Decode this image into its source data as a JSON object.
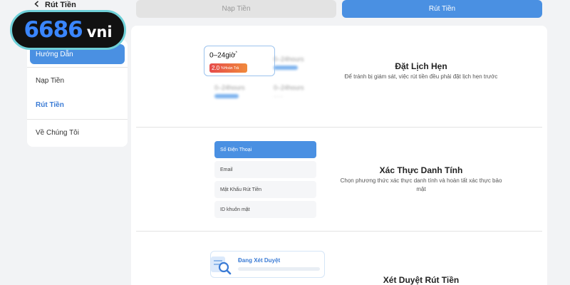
{
  "logo": {
    "number": "6686",
    "suffix": "vni"
  },
  "header": {
    "back_label": "Rút Tiền",
    "back_icon": "chevron-left-icon"
  },
  "tabs": [
    {
      "label": "Nạp Tiền",
      "active": false
    },
    {
      "label": "Rút Tiền",
      "active": true
    }
  ],
  "sidebar": {
    "items": [
      {
        "label": "Hướng Dẫn",
        "state": "highlighted"
      },
      {
        "label": "Nạp Tiền",
        "state": "normal"
      },
      {
        "label": "Rút Tiền",
        "state": "current"
      },
      {
        "label": "Về Chúng Tôi",
        "state": "normal"
      }
    ]
  },
  "sections": [
    {
      "title": "Đặt Lịch Hẹn",
      "description": "Để tránh bị giám sát, việc rút tiền đều phải đặt lịch hẹn trước",
      "illustration": {
        "card_time": "0–24giờ",
        "card_star": "*",
        "card_rate": "2.0",
        "card_rate_suffix": "%Hoàn Trả",
        "blurred_items": [
          "0–24hours",
          "0–24hours",
          "0–24hours",
          "0–24hours"
        ]
      }
    },
    {
      "title": "Xác Thực Danh Tính",
      "description": "Chọn phương thức xác thực danh tính và hoàn tất xác thực bảo mật",
      "illustration": {
        "options": [
          "Số Điện Thoại",
          "Email",
          "Mật Khẩu Rút Tiền",
          "ID khuôn mặt"
        ],
        "selected_index": 0
      }
    },
    {
      "title": "Xét Duyệt Rút Tiền",
      "illustration": {
        "status_label": "Đang Xét Duyệt",
        "status_icon": "magnifier-document-icon"
      }
    }
  ],
  "colors": {
    "accent": "#4a90e2",
    "logo_ring": "#6fd0d8",
    "pill_start": "#e64b4b",
    "pill_end": "#f08a3c"
  }
}
